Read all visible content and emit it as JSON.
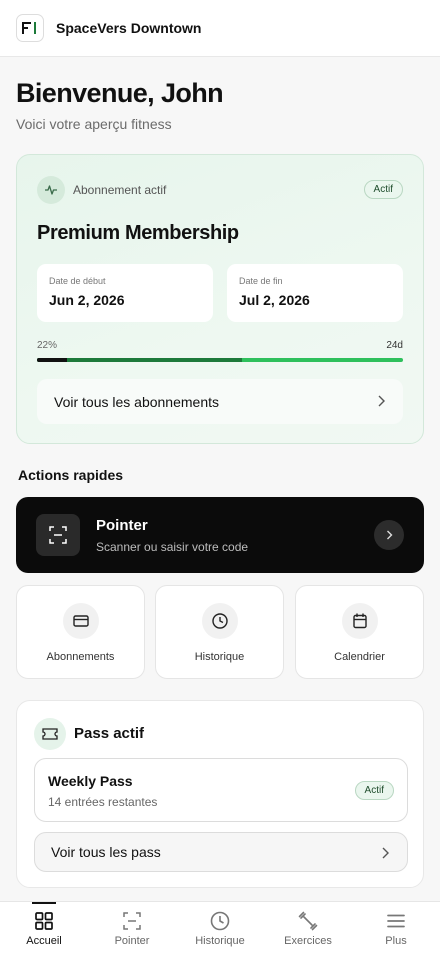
{
  "app": {
    "title": "SpaceVers Downtown",
    "logo_icon": "logo-icon"
  },
  "header": {
    "greeting": "Bienvenue, John",
    "subtitle": "Voici votre aperçu fitness"
  },
  "membership": {
    "label": "Abonnement actif",
    "status": "Actif",
    "title": "Premium Membership",
    "start_label": "Date de début",
    "start_value": "Jun 2, 2026",
    "end_label": "Date de fin",
    "end_value": "Jul 2, 2026",
    "progress_text": "22%",
    "progress_fraction": 0.56,
    "days_left": "24d",
    "view_all": "Voir tous les abonnements"
  },
  "quick_actions": {
    "title": "Actions rapides",
    "pointer": {
      "title": "Pointer",
      "subtitle": "Scanner ou saisir votre code"
    },
    "tiles": [
      {
        "label": "Abonnements",
        "icon": "card-icon"
      },
      {
        "label": "Historique",
        "icon": "clock-icon"
      },
      {
        "label": "Calendrier",
        "icon": "calendar-icon"
      }
    ]
  },
  "pass": {
    "title": "Pass actif",
    "item_name": "Weekly Pass",
    "item_sub": "14 entrées restantes",
    "item_status": "Actif",
    "view_all": "Voir tous les pass"
  },
  "nav": {
    "active": "Accueil",
    "items": [
      {
        "label": "Accueil",
        "icon": "home-grid-icon"
      },
      {
        "label": "Pointer",
        "icon": "scan-icon"
      },
      {
        "label": "Historique",
        "icon": "clock-icon"
      },
      {
        "label": "Exercices",
        "icon": "dumbbell-icon"
      },
      {
        "label": "Plus",
        "icon": "menu-icon"
      }
    ]
  },
  "colors": {
    "accent_green": "#1d7a3a",
    "card_bg": "#e7f5ec",
    "dark": "#0b0b0b"
  }
}
